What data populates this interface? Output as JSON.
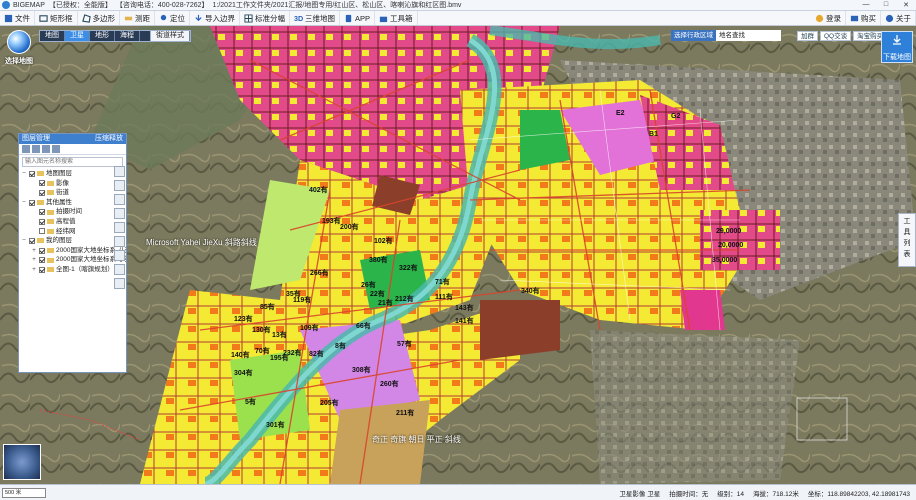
{
  "titlebar": {
    "app": "BIGEMAP",
    "edition": "【已授权：全能版】",
    "hotline": "【咨询电话：400-028-7262】",
    "path": "1:/2021工作文件夹/2021汇报/地图专用/红山区、松山区、喀喇沁旗和红区图.bmv",
    "min": "—",
    "max": "□",
    "close": "✕"
  },
  "toolbar": {
    "items": [
      "文件",
      "矩形框",
      "多边形",
      "测距",
      "定位",
      "导入边界",
      "标准分幅",
      "三维地图",
      "APP",
      "工具箱"
    ],
    "right": [
      "登录",
      "购买",
      "关于"
    ]
  },
  "logo_label": "选择地图",
  "map_tabs": [
    "地图",
    "卫星",
    "地形",
    "海程"
  ],
  "map_style_btn": "街道样式",
  "region_select": {
    "label": "选择行政区域",
    "placeholder": "地名查找"
  },
  "share": {
    "badge": "加群",
    "qq": "QQ交谈",
    "taobao": "淘宝购买"
  },
  "download_btn": "下载地图",
  "right_toolbar": [
    "工",
    "具",
    "列",
    "表"
  ],
  "layer_panel": {
    "title": "图层管理",
    "header_right": "压缩释放",
    "search_placeholder": "输入图元名称搜索",
    "tree": [
      {
        "label": "地图图层",
        "level": 1,
        "toggle": "−",
        "checked": true
      },
      {
        "label": "影像",
        "level": 2,
        "toggle": "",
        "checked": true
      },
      {
        "label": "街道",
        "level": 2,
        "toggle": "",
        "checked": true
      },
      {
        "label": "其他属性",
        "level": 1,
        "toggle": "−",
        "checked": true
      },
      {
        "label": "拍摄时间",
        "level": 2,
        "toggle": "",
        "checked": true
      },
      {
        "label": "高程值",
        "level": 2,
        "toggle": "",
        "checked": true
      },
      {
        "label": "经纬网",
        "level": 2,
        "toggle": "",
        "checked": false
      },
      {
        "label": "我的图层",
        "level": 1,
        "toggle": "−",
        "checked": true
      },
      {
        "label": "2000国家大地坐标系-八道",
        "level": 2,
        "toggle": "+",
        "checked": true
      },
      {
        "label": "2000国家大地坐标系-小渠",
        "level": 2,
        "toggle": "+",
        "checked": true
      },
      {
        "label": "全图-1（喀旗规划）",
        "level": 2,
        "toggle": "+",
        "checked": true
      }
    ]
  },
  "map_labels": [
    "402有",
    "340有",
    "322有",
    "380有",
    "266有",
    "212有",
    "111有",
    "141有",
    "205有",
    "301有",
    "304有",
    "232有",
    "119有",
    "195有",
    "70有",
    "82有",
    "102有",
    "8有",
    "211有",
    "21有",
    "85有",
    "29,0000",
    "20,0000",
    "35,0000",
    "57有",
    "71有",
    "143有",
    "193有",
    "22有",
    "66有",
    "200有",
    "13有",
    "35有",
    "5有",
    "26有",
    "123有",
    "130有",
    "140有",
    "109有",
    "308有",
    "260有",
    "G2",
    "E2",
    "B1"
  ],
  "watermarks": [
    "Microsoft Yahei JieXu 斜路斜线",
    "奇正 奇旗 朝日 平正 斜线"
  ],
  "status": {
    "source": "卫星影像 卫星",
    "capture_time": "拍摄时间：无",
    "level": "级别：14",
    "scale": "海拔：718.12米",
    "coords": "坐标：118.89842203, 42.18981743",
    "scale_bar": "500 米"
  },
  "colors": {
    "accent": "#3e7fce",
    "panel_header": "#3e7fce",
    "download": "#2f80d8"
  }
}
